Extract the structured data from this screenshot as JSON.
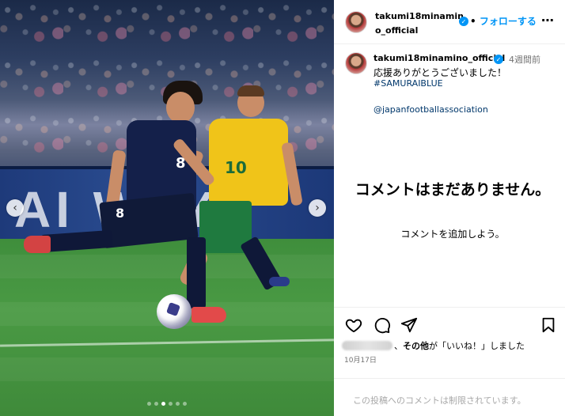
{
  "photo": {
    "ad_text": "AI  WAY",
    "jp_number": "8",
    "au_number": "10",
    "carousel": {
      "dot_count": 6,
      "active_index": 2
    }
  },
  "header": {
    "username_line1": "takumi18minamin",
    "username_line2": "o_official",
    "separator": "•",
    "follow_label": "フォローする",
    "more_icon": "⋯"
  },
  "caption": {
    "username": "takumi18minamino_official",
    "time_ago": "4週間前",
    "text": "応援ありがとうございました！",
    "hashtag": "#SAMURAIBLUE",
    "mention": "@japanfootballassociation"
  },
  "comments": {
    "empty_title": "コメントはまだありません。",
    "empty_subtitle": "コメントを追加しよう。"
  },
  "actions": {
    "icons": [
      "heart-icon",
      "comment-icon",
      "share-icon",
      "bookmark-icon"
    ]
  },
  "likes": {
    "separator": "、",
    "others": "その他",
    "suffix": "が「いいね！」しました"
  },
  "post_date": "10月17日",
  "restricted_notice": "この投稿へのコメントは制限されています。",
  "colors": {
    "link_blue": "#0095f6",
    "hashtag_blue": "#00376b",
    "muted_gray": "#737373"
  }
}
